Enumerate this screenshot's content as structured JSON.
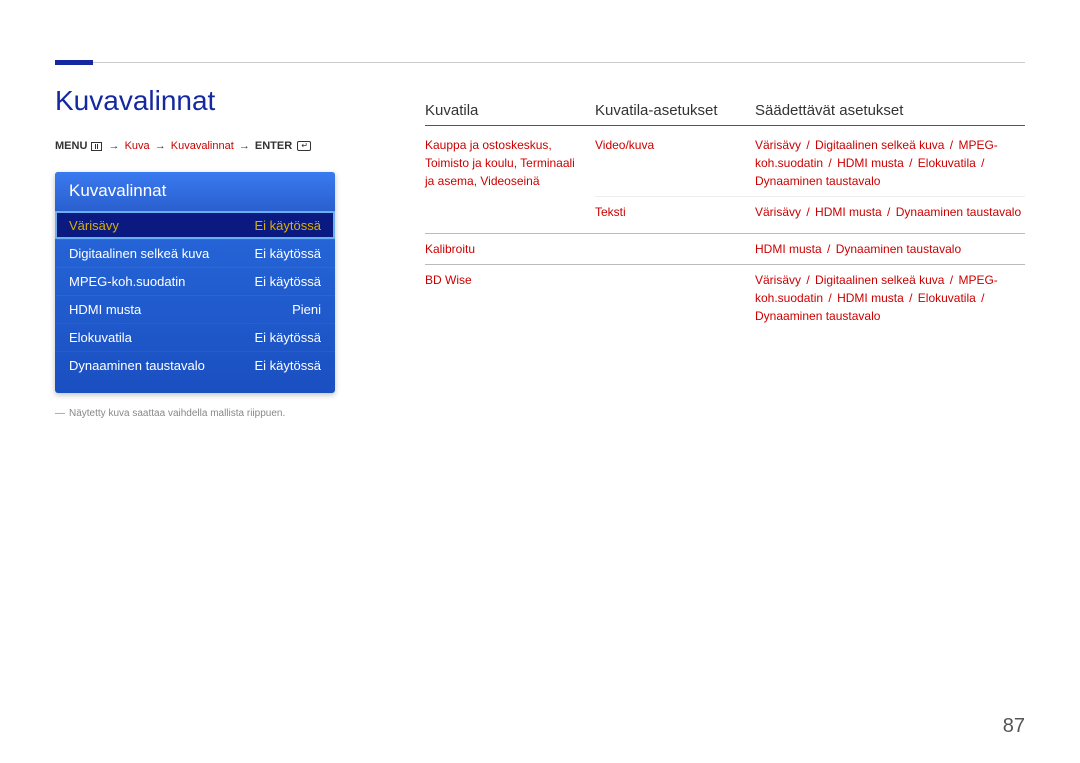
{
  "page_number": "87",
  "main_title": "Kuvavalinnat",
  "menu_path": {
    "menu_label": "MENU",
    "p1": "Kuva",
    "p2": "Kuvavalinnat",
    "enter_label": "ENTER"
  },
  "osd": {
    "title": "Kuvavalinnat",
    "rows": [
      {
        "label": "Värisävy",
        "value": "Ei käytössä",
        "selected": true
      },
      {
        "label": "Digitaalinen selkeä kuva",
        "value": "Ei käytössä",
        "selected": false
      },
      {
        "label": "MPEG-koh.suodatin",
        "value": "Ei käytössä",
        "selected": false
      },
      {
        "label": "HDMI musta",
        "value": "Pieni",
        "selected": false
      },
      {
        "label": "Elokuvatila",
        "value": "Ei käytössä",
        "selected": false
      },
      {
        "label": "Dynaaminen taustavalo",
        "value": "Ei käytössä",
        "selected": false
      }
    ]
  },
  "footnote": "Näytetty kuva saattaa vaihdella mallista riippuen.",
  "table": {
    "headers": {
      "c1": "Kuvatila",
      "c2": "Kuvatila-asetukset",
      "c3": "Säädettävät asetukset"
    },
    "groups": [
      {
        "mode": "Kauppa ja ostoskeskus, Toimisto ja koulu, Terminaali ja asema, Videoseinä",
        "rows": [
          {
            "setting": "Video/kuva",
            "options": [
              "Värisävy",
              "Digitaalinen selkeä kuva",
              "MPEG-koh.suodatin",
              "HDMI musta",
              "Elokuvatila",
              "Dynaaminen taustavalo"
            ]
          },
          {
            "setting": "Teksti",
            "options": [
              "Värisävy",
              "HDMI musta",
              "Dynaaminen taustavalo"
            ]
          }
        ]
      },
      {
        "mode": "Kalibroitu",
        "rows": [
          {
            "setting": "",
            "options": [
              "HDMI musta",
              "Dynaaminen taustavalo"
            ]
          }
        ]
      },
      {
        "mode": "BD Wise",
        "rows": [
          {
            "setting": "",
            "options": [
              "Värisävy",
              "Digitaalinen selkeä kuva",
              "MPEG-koh.suodatin",
              "HDMI musta",
              "Elokuvatila",
              "Dynaaminen taustavalo"
            ]
          }
        ]
      }
    ]
  }
}
